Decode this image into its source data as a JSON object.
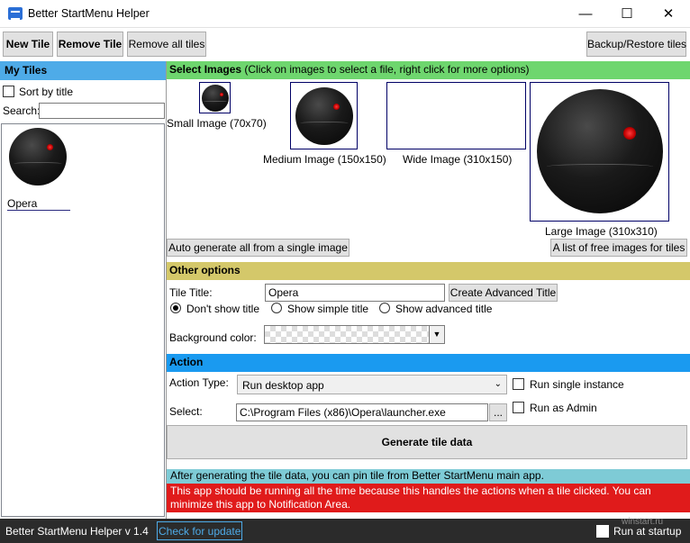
{
  "window": {
    "title": "Better StartMenu Helper",
    "minimize": "—",
    "maximize": "☐",
    "close": "✕"
  },
  "toolbar": {
    "new_tile": "New Tile",
    "remove_tile": "Remove Tile",
    "remove_all": "Remove all tiles",
    "backup_restore": "Backup/Restore tiles"
  },
  "left": {
    "header": "My Tiles",
    "sort_by_title": "Sort by title",
    "sort_checked": false,
    "search_label": "Search:",
    "search_value": "",
    "tiles": [
      {
        "name": "Opera"
      }
    ]
  },
  "images": {
    "header_bold": "Select Images",
    "header_note": " (Click on images to select a file, right click for more options)",
    "small": "Small Image (70x70)",
    "medium": "Medium Image (150x150)",
    "wide": "Wide Image (310x150)",
    "large": "Large Image (310x310)",
    "auto_generate": "Auto generate all from a single image",
    "free_images": "A list of free images for tiles"
  },
  "options": {
    "header": "Other options",
    "tile_title_label": "Tile Title:",
    "tile_title_value": "Opera",
    "create_advanced": "Create Advanced Title",
    "radio_dont_show": "Don't show title",
    "radio_simple": "Show simple title",
    "radio_advanced": "Show advanced title",
    "selected_radio": "dont_show",
    "bg_color_label": "Background color:"
  },
  "action": {
    "header": "Action",
    "action_type_label": "Action Type:",
    "action_type_value": "Run desktop app",
    "run_single": "Run single instance",
    "select_label": "Select:",
    "select_value": "C:\\Program Files (x86)\\Opera\\launcher.exe",
    "browse": "...",
    "run_admin": "Run as Admin",
    "generate": "Generate tile data"
  },
  "info": {
    "pin_note": "After generating the tile data, you can pin tile from Better StartMenu main app.",
    "warning": "This app should be running all the time because this handles the actions when a tile clicked. You can minimize this app to Notification Area."
  },
  "status": {
    "version": "Better StartMenu Helper v 1.4",
    "check_update": "Check for update",
    "run_startup": "Run at startup",
    "watermark": "winstart.ru"
  },
  "colors": {
    "my_tiles_header": "#4eabe8",
    "images_header": "#6ed66e",
    "options_header": "#d4c86a",
    "action_header": "#1a9af0",
    "info_bar": "#7ecbd6",
    "warning_bar": "#e01b1b",
    "status_bar": "#2b2b2b"
  },
  "icons": [
    "app-icon",
    "death-star-sphere-icon",
    "dropdown-arrow-icon",
    "checkbox-icon"
  ]
}
